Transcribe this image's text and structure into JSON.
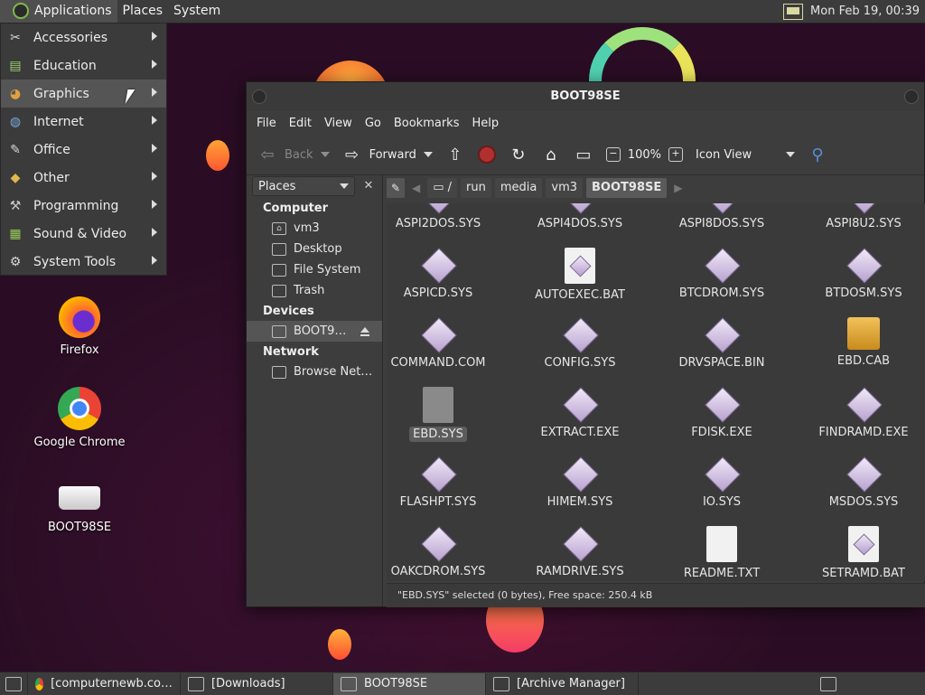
{
  "panel": {
    "menus": [
      "Applications",
      "Places",
      "System"
    ],
    "clock": "Mon Feb 19, 00:39"
  },
  "apps_menu": {
    "items": [
      {
        "label": "Accessories",
        "icon": "scissors-icon"
      },
      {
        "label": "Education",
        "icon": "education-icon"
      },
      {
        "label": "Graphics",
        "icon": "palette-icon"
      },
      {
        "label": "Internet",
        "icon": "globe-icon"
      },
      {
        "label": "Office",
        "icon": "office-icon"
      },
      {
        "label": "Other",
        "icon": "other-icon"
      },
      {
        "label": "Programming",
        "icon": "programming-icon"
      },
      {
        "label": "Sound & Video",
        "icon": "film-icon"
      },
      {
        "label": "System Tools",
        "icon": "gear-icon"
      }
    ]
  },
  "desktop": {
    "icons": [
      "Firefox",
      "Google Chrome",
      "BOOT98SE"
    ]
  },
  "window": {
    "title": "BOOT98SE",
    "menubar": [
      "File",
      "Edit",
      "View",
      "Go",
      "Bookmarks",
      "Help"
    ],
    "toolbar": {
      "back": "Back",
      "forward": "Forward",
      "zoom": "100%",
      "view_mode": "Icon View"
    },
    "sidebar": {
      "selector": "Places",
      "sections": [
        {
          "title": "Computer",
          "items": [
            "vm3",
            "Desktop",
            "File System",
            "Trash"
          ]
        },
        {
          "title": "Devices",
          "items": [
            "BOOT9…"
          ]
        },
        {
          "title": "Network",
          "items": [
            "Browse Net…"
          ]
        }
      ]
    },
    "path": [
      "/",
      "run",
      "media",
      "vm3",
      "BOOT98SE"
    ],
    "files": [
      {
        "name": "ASPI2DOS.SYS",
        "type": "sys"
      },
      {
        "name": "ASPI4DOS.SYS",
        "type": "sys"
      },
      {
        "name": "ASPI8DOS.SYS",
        "type": "sys"
      },
      {
        "name": "ASPI8U2.SYS",
        "type": "sys"
      },
      {
        "name": "ASPICD.SYS",
        "type": "sys"
      },
      {
        "name": "AUTOEXEC.BAT",
        "type": "doc-diamond"
      },
      {
        "name": "BTCDROM.SYS",
        "type": "sys"
      },
      {
        "name": "BTDOSM.SYS",
        "type": "sys"
      },
      {
        "name": "COMMAND.COM",
        "type": "sys"
      },
      {
        "name": "CONFIG.SYS",
        "type": "sys"
      },
      {
        "name": "DRVSPACE.BIN",
        "type": "sys"
      },
      {
        "name": "EBD.CAB",
        "type": "box"
      },
      {
        "name": "EBD.SYS",
        "type": "gray",
        "selected": true
      },
      {
        "name": "EXTRACT.EXE",
        "type": "sys"
      },
      {
        "name": "FDISK.EXE",
        "type": "sys"
      },
      {
        "name": "FINDRAMD.EXE",
        "type": "sys"
      },
      {
        "name": "FLASHPT.SYS",
        "type": "sys"
      },
      {
        "name": "HIMEM.SYS",
        "type": "sys"
      },
      {
        "name": "IO.SYS",
        "type": "sys"
      },
      {
        "name": "MSDOS.SYS",
        "type": "sys"
      },
      {
        "name": "OAKCDROM.SYS",
        "type": "sys"
      },
      {
        "name": "RAMDRIVE.SYS",
        "type": "sys"
      },
      {
        "name": "README.TXT",
        "type": "doc"
      },
      {
        "name": "SETRAMD.BAT",
        "type": "doc-diamond"
      }
    ],
    "status": "\"EBD.SYS\" selected (0 bytes), Free space: 250.4 kB"
  },
  "taskbar": [
    {
      "label": "[computernewb.co…",
      "icon": "chrome-icon"
    },
    {
      "label": "[Downloads]",
      "icon": "folder-icon"
    },
    {
      "label": "BOOT98SE",
      "icon": "drive-icon",
      "active": true
    },
    {
      "label": "[Archive Manager]",
      "icon": "archive-icon"
    }
  ]
}
